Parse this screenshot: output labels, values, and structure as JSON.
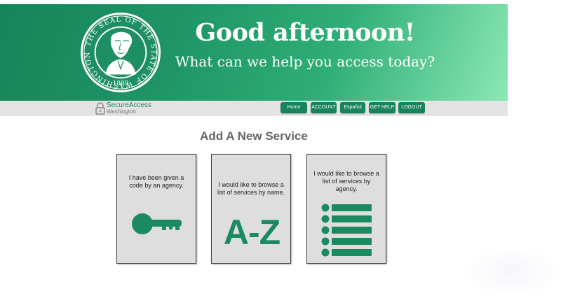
{
  "header": {
    "greeting": "Good afternoon!",
    "subtitle": "What can we help you access today?",
    "seal": {
      "ring_text": "THE SEAL OF THE STATE OF WASHINGTON",
      "year": "1889"
    }
  },
  "brand": {
    "line1": "SecureAccess",
    "line2": "Washington"
  },
  "nav": {
    "home": "Home",
    "account": "ACCOUNT",
    "espanol": "Español",
    "get_help": "GET HELP",
    "logout": "LOGOUT"
  },
  "main": {
    "heading": "Add A New Service",
    "cards": [
      {
        "text": "I have been given a code by an agency.",
        "icon": "key-icon"
      },
      {
        "text": "I would like to browse a list of services by name.",
        "icon": "a-z-icon",
        "icon_text": "A-Z"
      },
      {
        "text": "I would like to browse a list of services by agency.",
        "icon": "list-icon"
      }
    ]
  },
  "colors": {
    "brand_green": "#17845b",
    "banner_light": "#8ce8b4",
    "card_bg": "#dedede"
  }
}
